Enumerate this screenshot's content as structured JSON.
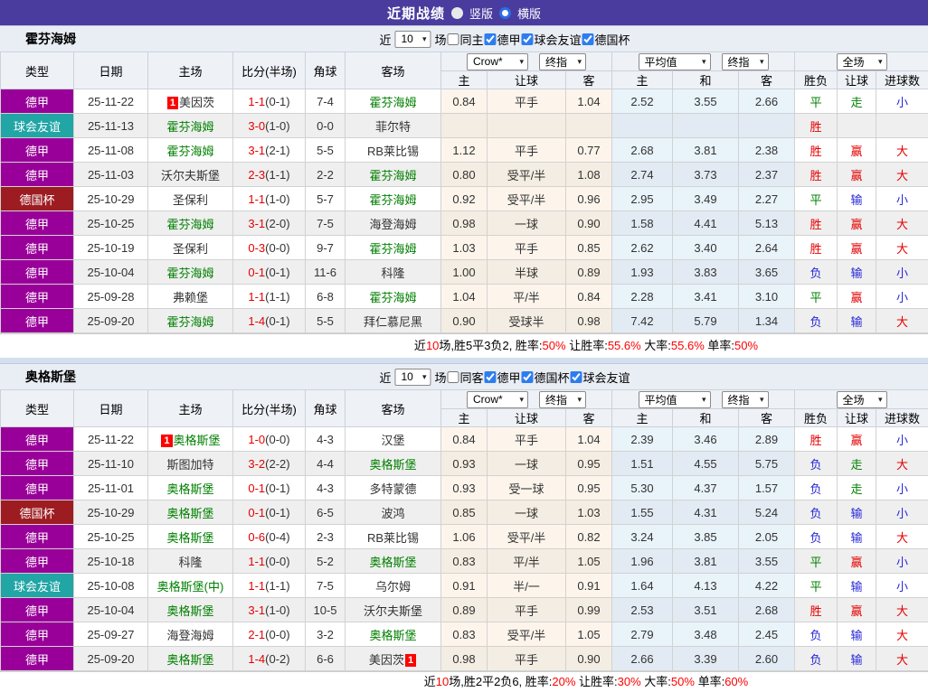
{
  "topbar": {
    "title": "近期战绩",
    "radios": [
      {
        "label": "竖版",
        "selected": false
      },
      {
        "label": "横版",
        "selected": true
      }
    ]
  },
  "columns": {
    "type": "类型",
    "date": "日期",
    "home": "主场",
    "score": "比分(半场)",
    "corner": "角球",
    "away": "客场",
    "asia_selects": [
      "Crow*",
      "终指"
    ],
    "avg_selects": [
      "平均值",
      "终指"
    ],
    "full_select": "全场",
    "sub": [
      "主",
      "让球",
      "客",
      "主",
      "和",
      "客",
      "胜负",
      "让球",
      "进球数"
    ]
  },
  "sections": [
    {
      "team": "霍芬海姆",
      "filter": {
        "near": "近",
        "count": "10",
        "games": "场",
        "same": "同主",
        "leagues": [
          "德甲",
          "球会友谊",
          "德国杯"
        ]
      },
      "rows": [
        {
          "type": "德甲",
          "tc": "bund",
          "date": "25-11-22",
          "home": "美因茨",
          "hb": "before",
          "hg": false,
          "score": "1-1",
          "half": "(0-1)",
          "corner": "7-4",
          "away": "霍芬海姆",
          "ab": null,
          "ag": true,
          "asia": [
            "0.84",
            "平手",
            "1.04"
          ],
          "avg": [
            "2.52",
            "3.55",
            "2.66"
          ],
          "res": [
            [
              "平",
              "g"
            ],
            [
              "走",
              "g"
            ],
            [
              "小",
              "b"
            ]
          ]
        },
        {
          "type": "球会友谊",
          "tc": "fri",
          "date": "25-11-13",
          "home": "霍芬海姆",
          "hb": null,
          "hg": true,
          "score": "3-0",
          "half": "(1-0)",
          "corner": "0-0",
          "away": "菲尔特",
          "ab": null,
          "ag": false,
          "asia": [
            "",
            "",
            ""
          ],
          "avg": [
            "",
            "",
            ""
          ],
          "res": [
            [
              "胜",
              "r"
            ],
            [
              "",
              ""
            ],
            [
              "",
              ""
            ]
          ]
        },
        {
          "type": "德甲",
          "tc": "bund",
          "date": "25-11-08",
          "home": "霍芬海姆",
          "hb": null,
          "hg": true,
          "score": "3-1",
          "half": "(2-1)",
          "corner": "5-5",
          "away": "RB莱比锡",
          "ab": null,
          "ag": false,
          "asia": [
            "1.12",
            "平手",
            "0.77"
          ],
          "avg": [
            "2.68",
            "3.81",
            "2.38"
          ],
          "res": [
            [
              "胜",
              "r"
            ],
            [
              "赢",
              "r"
            ],
            [
              "大",
              "r"
            ]
          ]
        },
        {
          "type": "德甲",
          "tc": "bund",
          "date": "25-11-03",
          "home": "沃尔夫斯堡",
          "hb": null,
          "hg": false,
          "score": "2-3",
          "half": "(1-1)",
          "corner": "2-2",
          "away": "霍芬海姆",
          "ab": null,
          "ag": true,
          "asia": [
            "0.80",
            "受平/半",
            "1.08"
          ],
          "avg": [
            "2.74",
            "3.73",
            "2.37"
          ],
          "res": [
            [
              "胜",
              "r"
            ],
            [
              "赢",
              "r"
            ],
            [
              "大",
              "r"
            ]
          ]
        },
        {
          "type": "德国杯",
          "tc": "cup",
          "date": "25-10-29",
          "home": "圣保利",
          "hb": null,
          "hg": false,
          "score": "1-1",
          "half": "(1-0)",
          "corner": "5-7",
          "away": "霍芬海姆",
          "ab": null,
          "ag": true,
          "asia": [
            "0.92",
            "受平/半",
            "0.96"
          ],
          "avg": [
            "2.95",
            "3.49",
            "2.27"
          ],
          "res": [
            [
              "平",
              "g"
            ],
            [
              "输",
              "b"
            ],
            [
              "小",
              "b"
            ]
          ]
        },
        {
          "type": "德甲",
          "tc": "bund",
          "date": "25-10-25",
          "home": "霍芬海姆",
          "hb": null,
          "hg": true,
          "score": "3-1",
          "half": "(2-0)",
          "corner": "7-5",
          "away": "海登海姆",
          "ab": null,
          "ag": false,
          "asia": [
            "0.98",
            "一球",
            "0.90"
          ],
          "avg": [
            "1.58",
            "4.41",
            "5.13"
          ],
          "res": [
            [
              "胜",
              "r"
            ],
            [
              "赢",
              "r"
            ],
            [
              "大",
              "r"
            ]
          ]
        },
        {
          "type": "德甲",
          "tc": "bund",
          "date": "25-10-19",
          "home": "圣保利",
          "hb": null,
          "hg": false,
          "score": "0-3",
          "half": "(0-0)",
          "corner": "9-7",
          "away": "霍芬海姆",
          "ab": null,
          "ag": true,
          "asia": [
            "1.03",
            "平手",
            "0.85"
          ],
          "avg": [
            "2.62",
            "3.40",
            "2.64"
          ],
          "res": [
            [
              "胜",
              "r"
            ],
            [
              "赢",
              "r"
            ],
            [
              "大",
              "r"
            ]
          ]
        },
        {
          "type": "德甲",
          "tc": "bund",
          "date": "25-10-04",
          "home": "霍芬海姆",
          "hb": null,
          "hg": true,
          "score": "0-1",
          "half": "(0-1)",
          "corner": "11-6",
          "away": "科隆",
          "ab": null,
          "ag": false,
          "asia": [
            "1.00",
            "半球",
            "0.89"
          ],
          "avg": [
            "1.93",
            "3.83",
            "3.65"
          ],
          "res": [
            [
              "负",
              "b"
            ],
            [
              "输",
              "b"
            ],
            [
              "小",
              "b"
            ]
          ]
        },
        {
          "type": "德甲",
          "tc": "bund",
          "date": "25-09-28",
          "home": "弗赖堡",
          "hb": null,
          "hg": false,
          "score": "1-1",
          "half": "(1-1)",
          "corner": "6-8",
          "away": "霍芬海姆",
          "ab": null,
          "ag": true,
          "asia": [
            "1.04",
            "平/半",
            "0.84"
          ],
          "avg": [
            "2.28",
            "3.41",
            "3.10"
          ],
          "res": [
            [
              "平",
              "g"
            ],
            [
              "赢",
              "r"
            ],
            [
              "小",
              "b"
            ]
          ]
        },
        {
          "type": "德甲",
          "tc": "bund",
          "date": "25-09-20",
          "home": "霍芬海姆",
          "hb": null,
          "hg": true,
          "score": "1-4",
          "half": "(0-1)",
          "corner": "5-5",
          "away": "拜仁慕尼黑",
          "ab": null,
          "ag": false,
          "asia": [
            "0.90",
            "受球半",
            "0.98"
          ],
          "avg": [
            "7.42",
            "5.79",
            "1.34"
          ],
          "res": [
            [
              "负",
              "b"
            ],
            [
              "输",
              "b"
            ],
            [
              "大",
              "r"
            ]
          ]
        }
      ],
      "summary": [
        {
          "t": "近",
          "red": false
        },
        {
          "t": "10",
          "red": true
        },
        {
          "t": "场,胜5平3负2, 胜率:",
          "red": false
        },
        {
          "t": "50%",
          "red": true
        },
        {
          "t": " 让胜率:",
          "red": false
        },
        {
          "t": "55.6%",
          "red": true
        },
        {
          "t": " 大率:",
          "red": false
        },
        {
          "t": "55.6%",
          "red": true
        },
        {
          "t": " 单率:",
          "red": false
        },
        {
          "t": "50%",
          "red": true
        }
      ]
    },
    {
      "team": "奥格斯堡",
      "filter": {
        "near": "近",
        "count": "10",
        "games": "场",
        "same": "同客",
        "leagues": [
          "德甲",
          "德国杯",
          "球会友谊"
        ]
      },
      "rows": [
        {
          "type": "德甲",
          "tc": "bund",
          "date": "25-11-22",
          "home": "奥格斯堡",
          "hb": "before",
          "hg": true,
          "score": "1-0",
          "half": "(0-0)",
          "corner": "4-3",
          "away": "汉堡",
          "ab": null,
          "ag": false,
          "asia": [
            "0.84",
            "平手",
            "1.04"
          ],
          "avg": [
            "2.39",
            "3.46",
            "2.89"
          ],
          "res": [
            [
              "胜",
              "r"
            ],
            [
              "赢",
              "r"
            ],
            [
              "小",
              "b"
            ]
          ]
        },
        {
          "type": "德甲",
          "tc": "bund",
          "date": "25-11-10",
          "home": "斯图加特",
          "hb": null,
          "hg": false,
          "score": "3-2",
          "half": "(2-2)",
          "corner": "4-4",
          "away": "奥格斯堡",
          "ab": null,
          "ag": true,
          "asia": [
            "0.93",
            "一球",
            "0.95"
          ],
          "avg": [
            "1.51",
            "4.55",
            "5.75"
          ],
          "res": [
            [
              "负",
              "b"
            ],
            [
              "走",
              "g"
            ],
            [
              "大",
              "r"
            ]
          ]
        },
        {
          "type": "德甲",
          "tc": "bund",
          "date": "25-11-01",
          "home": "奥格斯堡",
          "hb": null,
          "hg": true,
          "score": "0-1",
          "half": "(0-1)",
          "corner": "4-3",
          "away": "多特蒙德",
          "ab": null,
          "ag": false,
          "asia": [
            "0.93",
            "受一球",
            "0.95"
          ],
          "avg": [
            "5.30",
            "4.37",
            "1.57"
          ],
          "res": [
            [
              "负",
              "b"
            ],
            [
              "走",
              "g"
            ],
            [
              "小",
              "b"
            ]
          ]
        },
        {
          "type": "德国杯",
          "tc": "cup",
          "date": "25-10-29",
          "home": "奥格斯堡",
          "hb": null,
          "hg": true,
          "score": "0-1",
          "half": "(0-1)",
          "corner": "6-5",
          "away": "波鸿",
          "ab": null,
          "ag": false,
          "asia": [
            "0.85",
            "一球",
            "1.03"
          ],
          "avg": [
            "1.55",
            "4.31",
            "5.24"
          ],
          "res": [
            [
              "负",
              "b"
            ],
            [
              "输",
              "b"
            ],
            [
              "小",
              "b"
            ]
          ]
        },
        {
          "type": "德甲",
          "tc": "bund",
          "date": "25-10-25",
          "home": "奥格斯堡",
          "hb": null,
          "hg": true,
          "score": "0-6",
          "half": "(0-4)",
          "corner": "2-3",
          "away": "RB莱比锡",
          "ab": null,
          "ag": false,
          "asia": [
            "1.06",
            "受平/半",
            "0.82"
          ],
          "avg": [
            "3.24",
            "3.85",
            "2.05"
          ],
          "res": [
            [
              "负",
              "b"
            ],
            [
              "输",
              "b"
            ],
            [
              "大",
              "r"
            ]
          ]
        },
        {
          "type": "德甲",
          "tc": "bund",
          "date": "25-10-18",
          "home": "科隆",
          "hb": null,
          "hg": false,
          "score": "1-1",
          "half": "(0-0)",
          "corner": "5-2",
          "away": "奥格斯堡",
          "ab": null,
          "ag": true,
          "asia": [
            "0.83",
            "平/半",
            "1.05"
          ],
          "avg": [
            "1.96",
            "3.81",
            "3.55"
          ],
          "res": [
            [
              "平",
              "g"
            ],
            [
              "赢",
              "r"
            ],
            [
              "小",
              "b"
            ]
          ]
        },
        {
          "type": "球会友谊",
          "tc": "fri",
          "date": "25-10-08",
          "home": "奥格斯堡(中)",
          "hb": null,
          "hg": true,
          "score": "1-1",
          "half": "(1-1)",
          "corner": "7-5",
          "away": "乌尔姆",
          "ab": null,
          "ag": false,
          "asia": [
            "0.91",
            "半/一",
            "0.91"
          ],
          "avg": [
            "1.64",
            "4.13",
            "4.22"
          ],
          "res": [
            [
              "平",
              "g"
            ],
            [
              "输",
              "b"
            ],
            [
              "小",
              "b"
            ]
          ]
        },
        {
          "type": "德甲",
          "tc": "bund",
          "date": "25-10-04",
          "home": "奥格斯堡",
          "hb": null,
          "hg": true,
          "score": "3-1",
          "half": "(1-0)",
          "corner": "10-5",
          "away": "沃尔夫斯堡",
          "ab": null,
          "ag": false,
          "asia": [
            "0.89",
            "平手",
            "0.99"
          ],
          "avg": [
            "2.53",
            "3.51",
            "2.68"
          ],
          "res": [
            [
              "胜",
              "r"
            ],
            [
              "赢",
              "r"
            ],
            [
              "大",
              "r"
            ]
          ]
        },
        {
          "type": "德甲",
          "tc": "bund",
          "date": "25-09-27",
          "home": "海登海姆",
          "hb": null,
          "hg": false,
          "score": "2-1",
          "half": "(0-0)",
          "corner": "3-2",
          "away": "奥格斯堡",
          "ab": null,
          "ag": true,
          "asia": [
            "0.83",
            "受平/半",
            "1.05"
          ],
          "avg": [
            "2.79",
            "3.48",
            "2.45"
          ],
          "res": [
            [
              "负",
              "b"
            ],
            [
              "输",
              "b"
            ],
            [
              "大",
              "r"
            ]
          ]
        },
        {
          "type": "德甲",
          "tc": "bund",
          "date": "25-09-20",
          "home": "奥格斯堡",
          "hb": null,
          "hg": true,
          "score": "1-4",
          "half": "(0-2)",
          "corner": "6-6",
          "away": "美因茨",
          "ab": "after",
          "ag": false,
          "asia": [
            "0.98",
            "平手",
            "0.90"
          ],
          "avg": [
            "2.66",
            "3.39",
            "2.60"
          ],
          "res": [
            [
              "负",
              "b"
            ],
            [
              "输",
              "b"
            ],
            [
              "大",
              "r"
            ]
          ]
        }
      ],
      "summary": [
        {
          "t": "近",
          "red": false
        },
        {
          "t": "10",
          "red": true
        },
        {
          "t": "场,胜2平2负6, 胜率:",
          "red": false
        },
        {
          "t": "20%",
          "red": true
        },
        {
          "t": " 让胜率:",
          "red": false
        },
        {
          "t": "30%",
          "red": true
        },
        {
          "t": " 大率:",
          "red": false
        },
        {
          "t": "50%",
          "red": true
        },
        {
          "t": " 单率:",
          "red": false
        },
        {
          "t": "60%",
          "red": true
        }
      ]
    }
  ]
}
